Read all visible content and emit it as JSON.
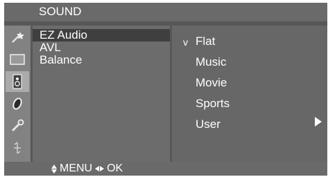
{
  "menu": {
    "title": "SOUND",
    "categories": [
      {
        "icon": "picture-wand-icon"
      },
      {
        "icon": "screen-icon"
      },
      {
        "icon": "speaker-icon",
        "selected": true
      },
      {
        "icon": "timer-icon"
      },
      {
        "icon": "special-wrench-icon"
      },
      {
        "icon": "setup-icon"
      }
    ],
    "items": [
      {
        "label": "EZ Audio",
        "selected": true
      },
      {
        "label": "AVL"
      },
      {
        "label": "Balance"
      }
    ],
    "submenu": {
      "check_mark": "v",
      "options": [
        {
          "label": "Flat",
          "checked": true
        },
        {
          "label": "Music"
        },
        {
          "label": "Movie"
        },
        {
          "label": "Sports"
        },
        {
          "label": "User",
          "has_submenu": true
        }
      ]
    },
    "help": {
      "menu_label": "MENU",
      "ok_label": "OK"
    }
  },
  "colors": {
    "screen_bg": "#575757",
    "highlight": "#3f3f3f",
    "selected_icon_bg": "#ababab"
  }
}
